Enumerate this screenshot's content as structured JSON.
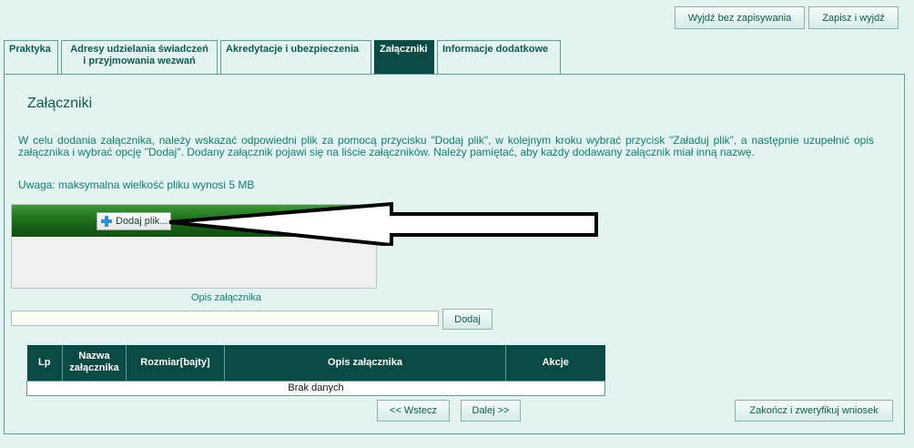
{
  "header": {
    "exit_no_save_label": "Wyjdź bez zapisywania",
    "save_exit_label": "Zapisz i wyjdź"
  },
  "tabs": [
    {
      "label": "Praktyka"
    },
    {
      "label_line1": "Adresy udzielania świadczeń",
      "label_line2": "i przyjmowania wezwań"
    },
    {
      "label": "Akredytacje i ubezpieczenia"
    },
    {
      "label": "Załączniki",
      "active": true
    },
    {
      "label": "Informacje dodatkowe"
    }
  ],
  "main": {
    "title": "Załączniki",
    "description": "W celu dodania załącznika, należy wskazać odpowiedni plik za pomocą przycisku \"Dodaj plik\", w kolejnym kroku wybrać przycisk \"Załaduj plik\", a następnie uzupełnić opis załącznika i wybrać opcję \"Dodaj\". Dodany załącznik pojawi się na liście załączników. Należy pamiętać, aby każdy dodawany załącznik miał inną nazwę.",
    "note": "Uwaga: maksymalna wielkość pliku wynosi 5 MB"
  },
  "uploader": {
    "add_file_label": "Dodaj plik..."
  },
  "attachment_form": {
    "description_label": "Opis załącznika",
    "description_value": "",
    "add_label": "Dodaj"
  },
  "table": {
    "columns": [
      "Lp",
      "Nazwa załącznika",
      "Rozmiar[bajty]",
      "Opis załącznika",
      "Akcje"
    ],
    "empty_text": "Brak danych"
  },
  "footer": {
    "back_label": "<< Wstecz",
    "next_label": "Dalej >>",
    "finish_label": "Zakończ i zweryfikuj wniosek"
  },
  "colors": {
    "page_bg": "#e2f3f2",
    "accent_dark": "#0b4a44",
    "text": "#0f7e70",
    "uploader_bar": "#1f6f1c"
  }
}
